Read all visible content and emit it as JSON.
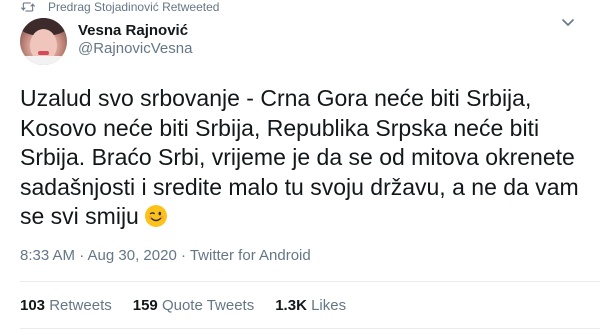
{
  "retweet_context": {
    "text": "Predrag Stojadinović Retweeted",
    "icon": "retweet-icon"
  },
  "author": {
    "display_name": "Vesna Rajnović",
    "handle": "@RajnovicVesna"
  },
  "tweet": {
    "lines": [
      "Uzalud svo srbovanje - Crna Gora neće biti Srbija,",
      "Kosovo neće biti Srbija, Republika Srpska neće biti",
      "Srbija. Braćo Srbi, vrijeme je da se od mitova okrenete",
      "sadašnjosti i sredite malo tu svoju državu, a ne da vam",
      "se svi smiju"
    ],
    "emoji": "winking-face-emoji"
  },
  "meta": {
    "timestamp": "8:33 AM · Aug 30, 2020 · Twitter for Android"
  },
  "stats": {
    "retweets": {
      "count": "103",
      "label": "Retweets"
    },
    "quote_tweets": {
      "count": "159",
      "label": "Quote Tweets"
    },
    "likes": {
      "count": "1.3K",
      "label": "Likes"
    }
  },
  "colors": {
    "secondary_text": "#657786",
    "primary_text": "#14171a",
    "divider": "#e6ecf0"
  }
}
